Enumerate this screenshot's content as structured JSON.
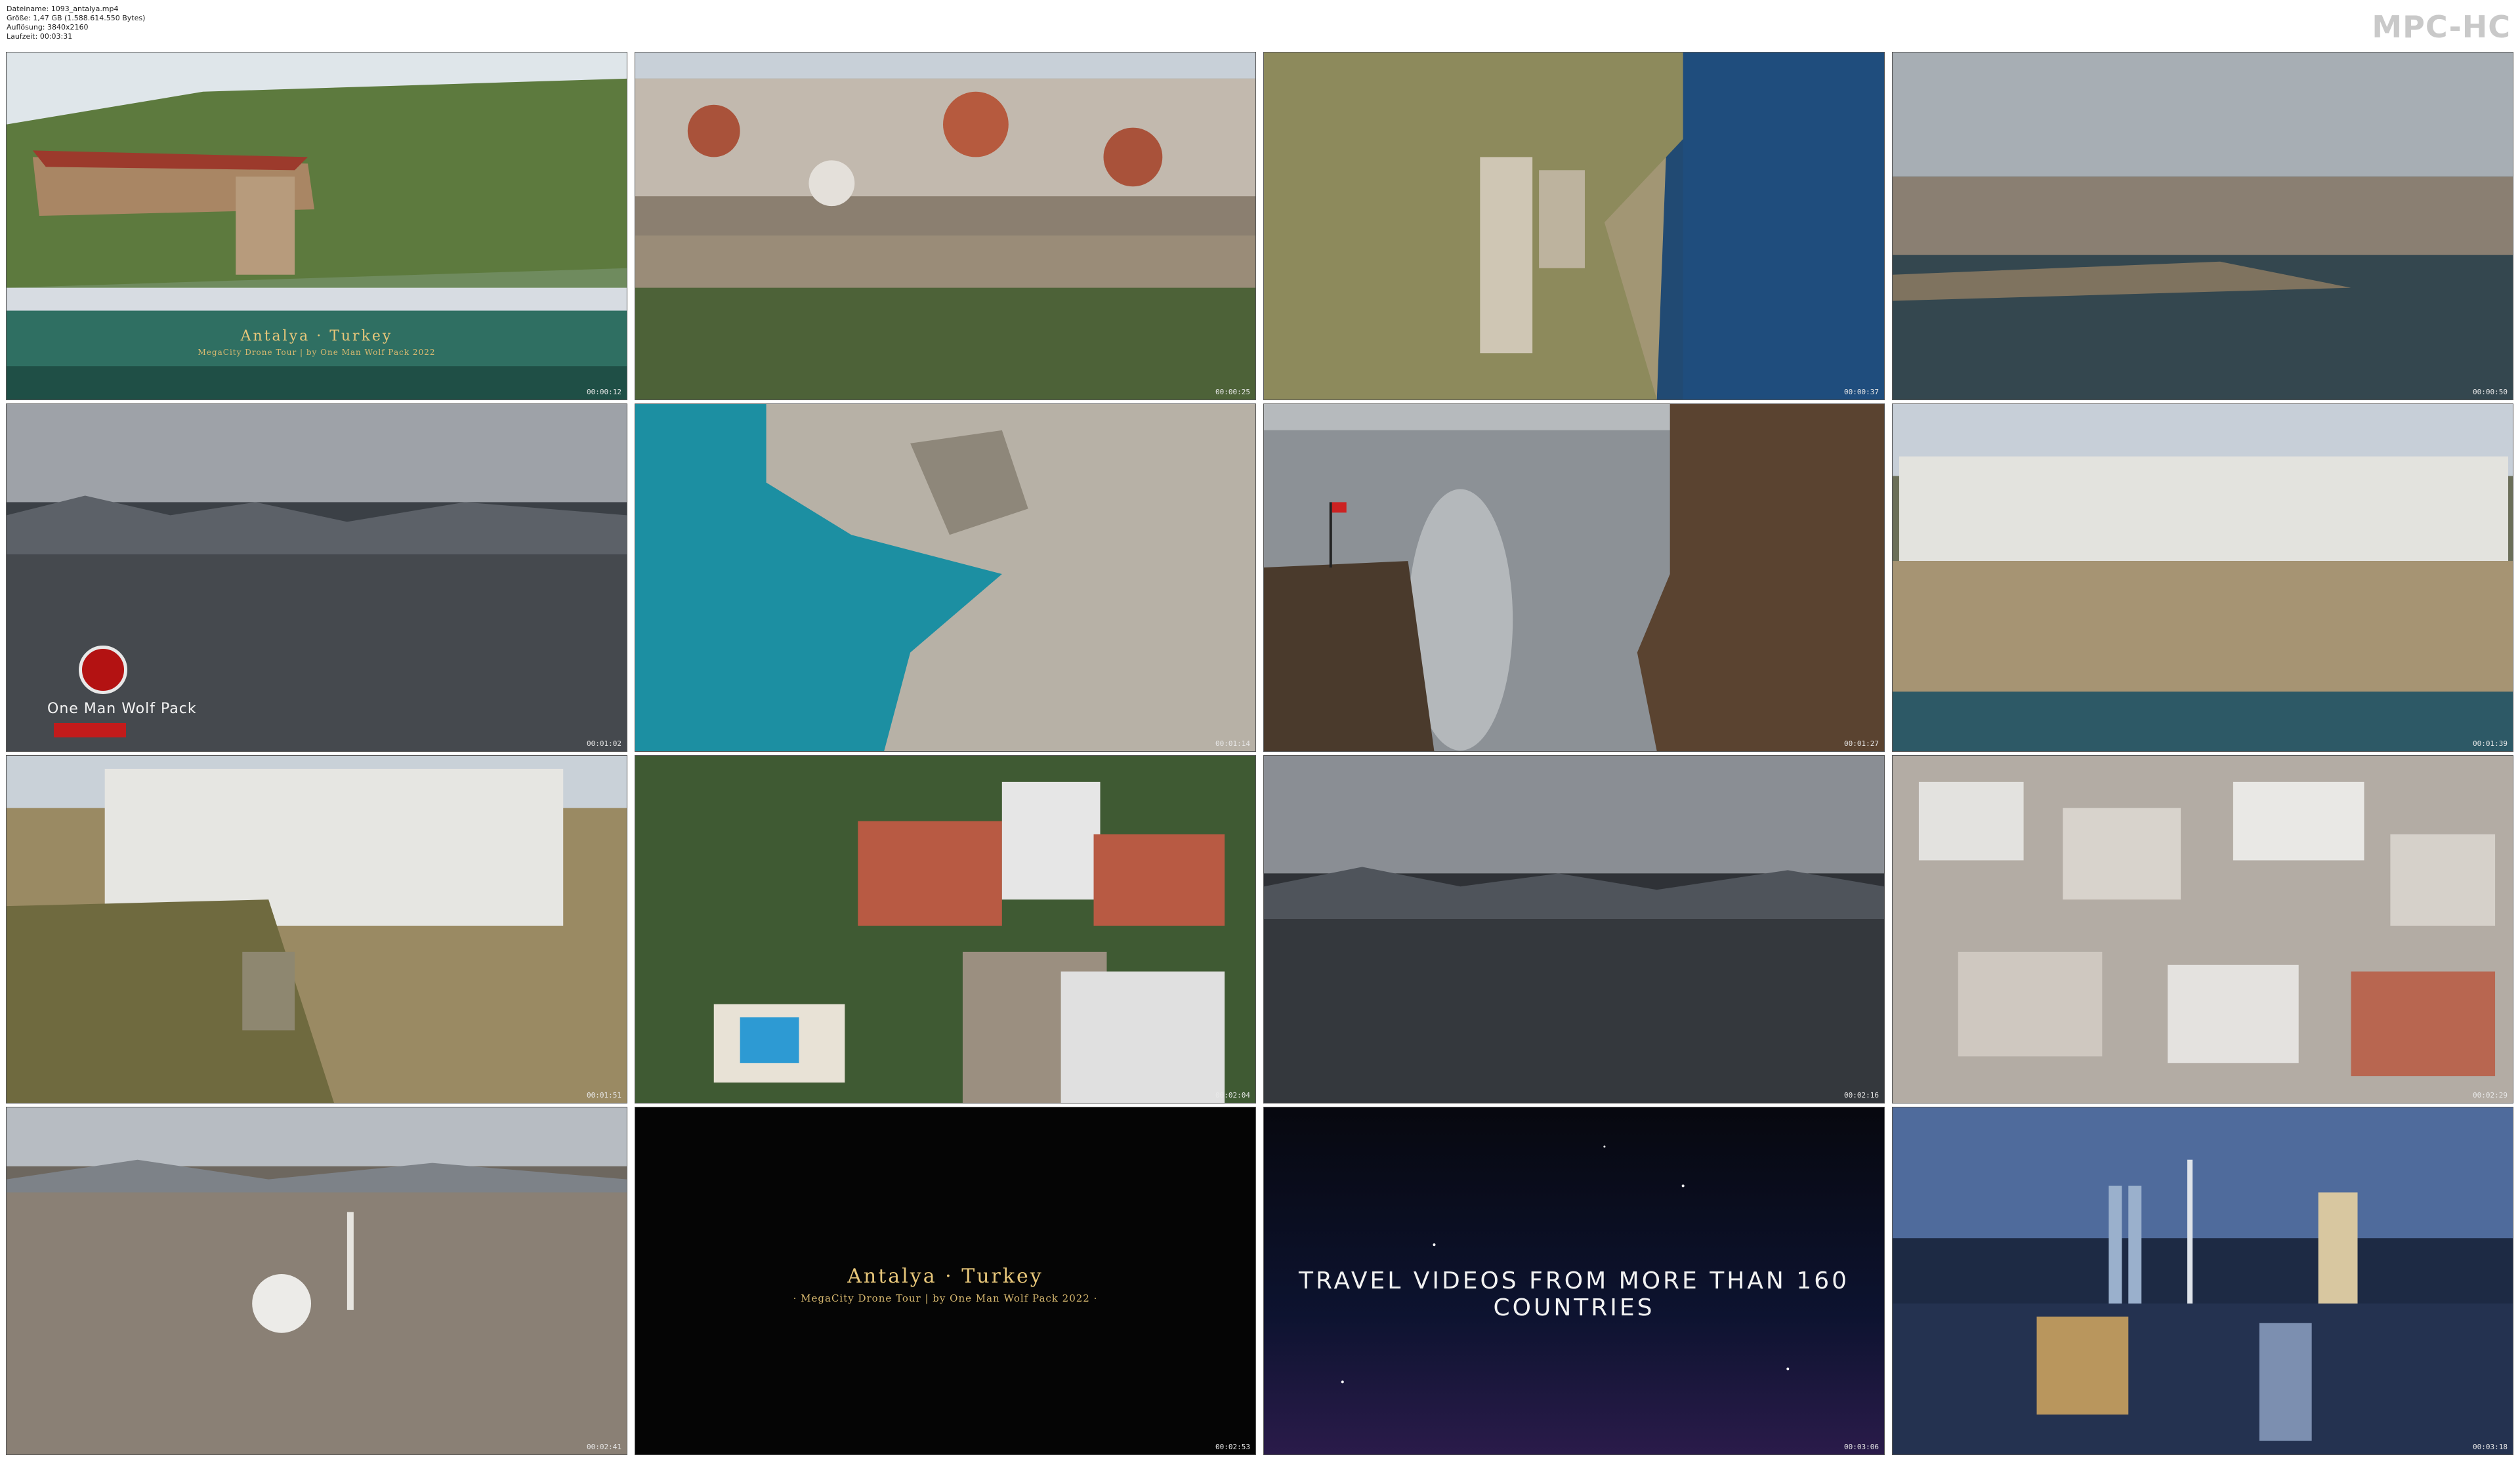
{
  "header": {
    "filename": "Dateiname: 1093_antalya.mp4",
    "size": "Größe: 1,47 GB (1.588.614.550 Bytes)",
    "resolution": "Auflösung: 3840x2160",
    "duration": "Laufzeit: 00:03:31",
    "player_logo": "MPC-HC"
  },
  "thumbnails": [
    {
      "time": "00:00:12",
      "title": "Antalya · Turkey",
      "subtitle": "MegaCity Drone Tour | by One Man Wolf Pack 2022"
    },
    {
      "time": "00:00:25"
    },
    {
      "time": "00:00:37"
    },
    {
      "time": "00:00:50"
    },
    {
      "time": "00:01:02",
      "channel": "One Man Wolf Pack"
    },
    {
      "time": "00:01:14"
    },
    {
      "time": "00:01:27"
    },
    {
      "time": "00:01:39"
    },
    {
      "time": "00:01:51"
    },
    {
      "time": "00:02:04"
    },
    {
      "time": "00:02:16"
    },
    {
      "time": "00:02:29"
    },
    {
      "time": "00:02:41"
    },
    {
      "time": "00:02:53",
      "title": "Antalya · Turkey",
      "subtitle": "· MegaCity Drone Tour | by One Man Wolf Pack 2022 ·"
    },
    {
      "time": "00:03:06",
      "caption": "TRAVEL VIDEOS FROM MORE THAN 160 COUNTRIES"
    },
    {
      "time": "00:03:18"
    }
  ]
}
